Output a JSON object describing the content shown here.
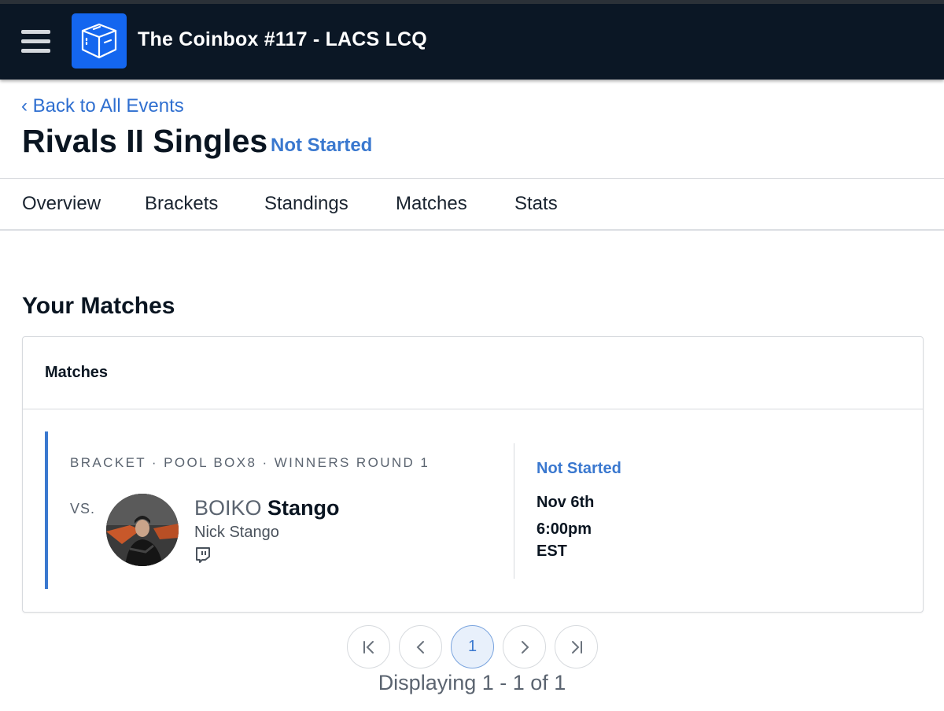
{
  "header": {
    "menu_icon": "hamburger-menu-icon",
    "logo_icon": "coinbox-logo-icon",
    "title": "The Coinbox #117 - LACS LCQ"
  },
  "event": {
    "back_link": "‹ Back to All Events",
    "title": "Rivals II Singles",
    "status": "Not Started"
  },
  "tabs": [
    {
      "label": "Overview"
    },
    {
      "label": "Brackets"
    },
    {
      "label": "Standings"
    },
    {
      "label": "Matches"
    },
    {
      "label": "Stats"
    }
  ],
  "section_title": "Your Matches",
  "card": {
    "header": "Matches",
    "match": {
      "path": "Bracket · Pool BOX8 · Winners Round 1",
      "vs_label": "VS.",
      "opponent": {
        "prefix": "BOIKO",
        "tag": "Stango",
        "name": "Nick Stango",
        "stream_icon": "twitch-icon"
      },
      "status": "Not Started",
      "date": "Nov 6th",
      "time": "6:00pm",
      "timezone": "EST"
    }
  },
  "pagination": {
    "first_icon": "first-page-icon",
    "prev_icon": "chevron-left-icon",
    "current_page": "1",
    "next_icon": "chevron-right-icon",
    "last_icon": "last-page-icon",
    "info": "Displaying 1 - 1 of 1"
  },
  "colors": {
    "topbar": "#0b1725",
    "logo_bg": "#1466ef",
    "accent": "#3a78cf"
  }
}
